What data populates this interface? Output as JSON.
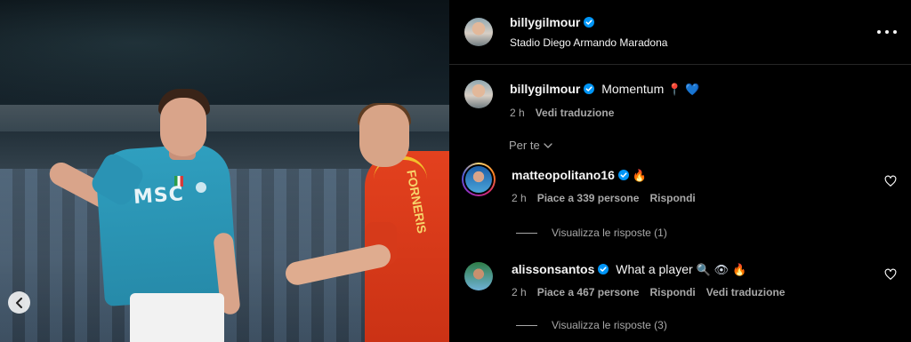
{
  "post": {
    "username": "billygilmour",
    "location": "Stadio Diego Armando Maradona",
    "caption_text": "Momentum",
    "caption_emojis": [
      "📍",
      "💙"
    ],
    "caption_time": "2 h",
    "caption_translate": "Vedi traduzione",
    "photo_jersey_text": "MSC",
    "photo_back_name": "FORNERIS"
  },
  "sort_label": "Per te",
  "comments": [
    {
      "username": "matteopolitano16",
      "text": "",
      "emojis": [
        "🔥"
      ],
      "time": "2 h",
      "likes": "Piace a 339 persone",
      "reply": "Rispondi",
      "translate": "",
      "view_replies": "Visualizza le risposte (1)"
    },
    {
      "username": "alissonsantos",
      "text": "What a player",
      "emojis": [
        "🔍",
        "👁",
        "🔥"
      ],
      "time": "2 h",
      "likes": "Piace a 467 persone",
      "reply": "Rispondi",
      "translate": "Vedi traduzione",
      "view_replies": "Visualizza le risposte (3)"
    }
  ],
  "colors": {
    "background": "#000000",
    "text": "#f5f5f5",
    "secondary_text": "#a8a8a8",
    "verified": "#0095f6"
  },
  "icons": {
    "verified": "verified-badge-icon",
    "more": "more-options-icon",
    "like": "heart-icon",
    "chevron": "chevron-down-icon",
    "carousel_prev": "chevron-left-icon"
  }
}
